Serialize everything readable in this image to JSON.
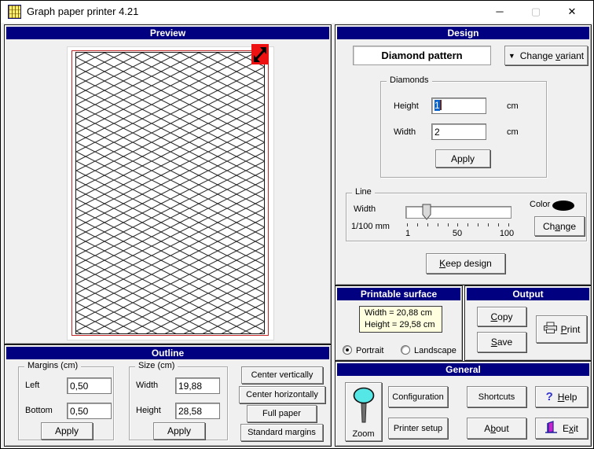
{
  "window": {
    "title": "Graph paper printer 4.21"
  },
  "titlebar_icons": {
    "minimize": "─",
    "maximize": "▢",
    "close": "✕"
  },
  "preview": {
    "header": "Preview"
  },
  "design": {
    "header": "Design",
    "pattern_name": "Diamond pattern",
    "change_variant": {
      "icon": "▼",
      "pre": "Change ",
      "mn": "v",
      "post": "ariant"
    },
    "diamonds": {
      "legend": "Diamonds",
      "height_label": "Height",
      "height_value": "1",
      "height_unit": "cm",
      "width_label": "Width",
      "width_value": "2",
      "width_unit": "cm",
      "apply": "Apply"
    },
    "line": {
      "legend": "Line",
      "width_label": "Width",
      "unit_label": "1/100 mm",
      "tick_labels": [
        "1",
        "50",
        "100"
      ],
      "slider_value_pct": 16,
      "color_label": "Color",
      "color_value": "#000000",
      "change": {
        "pre": "Ch",
        "mn": "a",
        "post": "nge"
      }
    },
    "keep_design": {
      "pre": "",
      "mn": "K",
      "post": "eep design"
    }
  },
  "printable_surface": {
    "header": "Printable surface",
    "width_text": "Width = 20,88 cm",
    "height_text": "Height = 29,58 cm",
    "portrait": "Portrait",
    "landscape": "Landscape",
    "selected_orientation": "Portrait"
  },
  "output": {
    "header": "Output",
    "copy": {
      "pre": "",
      "mn": "C",
      "post": "opy"
    },
    "save": {
      "pre": "",
      "mn": "S",
      "post": "ave"
    },
    "print": {
      "pre": "",
      "mn": "P",
      "post": "rint"
    }
  },
  "outline": {
    "header": "Outline",
    "margins": {
      "legend": "Margins (cm)",
      "left_label": "Left",
      "left_value": "0,50",
      "bottom_label": "Bottom",
      "bottom_value": "0,50",
      "apply": "Apply"
    },
    "size": {
      "legend": "Size (cm)",
      "width_label": "Width",
      "width_value": "19,88",
      "height_label": "Height",
      "height_value": "28,58",
      "apply": "Apply"
    },
    "center_vertically": "Center vertically",
    "center_horizontally": "Center horizontally",
    "full_paper": "Full paper",
    "standard_margins": "Standard margins"
  },
  "general": {
    "header": "General",
    "zoom": "Zoom",
    "configuration": "Configuration",
    "shortcuts": "Shortcuts",
    "help": {
      "icon": "?",
      "pre": "",
      "mn": "H",
      "post": "elp"
    },
    "printer_setup": "Printer setup",
    "about": {
      "pre": "A",
      "mn": "b",
      "post": "out"
    },
    "exit": {
      "pre": "E",
      "mn": "x",
      "post": "it"
    }
  },
  "colors": {
    "header_bg": "#000080",
    "info_box_bg": "#ffffe0",
    "selection_blue": "#0a64ce",
    "paper_outline_red": "#c22727",
    "zoom_corner_red": "#ee1111",
    "line_color": "#000000"
  }
}
